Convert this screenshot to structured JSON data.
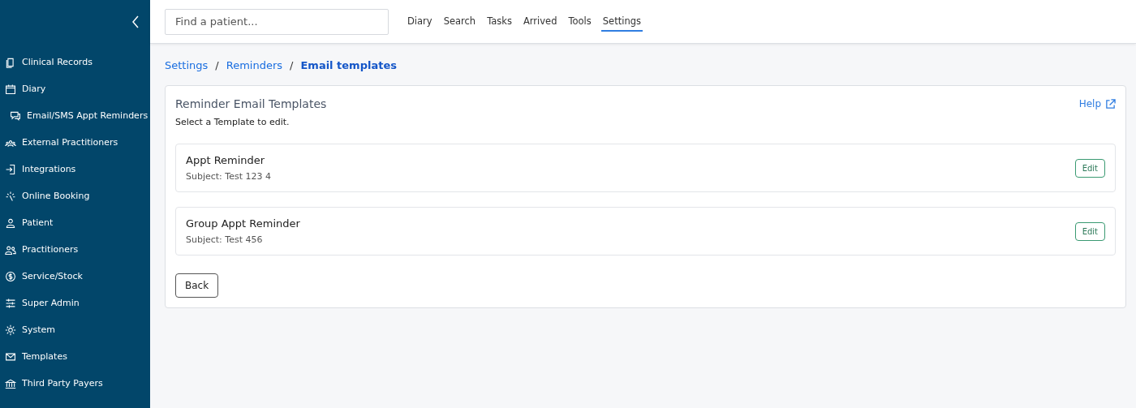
{
  "sidebar": {
    "items": [
      {
        "label": "Clinical Records"
      },
      {
        "label": "Diary",
        "children": [
          {
            "label": "Email/SMS Appt Reminders"
          }
        ]
      },
      {
        "label": "External Practitioners"
      },
      {
        "label": "Integrations"
      },
      {
        "label": "Online Booking"
      },
      {
        "label": "Patient"
      },
      {
        "label": "Practitioners"
      },
      {
        "label": "Service/Stock"
      },
      {
        "label": "Super Admin"
      },
      {
        "label": "System"
      },
      {
        "label": "Templates"
      },
      {
        "label": "Third Party Payers"
      }
    ]
  },
  "search": {
    "placeholder": "Find a patient..."
  },
  "nav": [
    {
      "label": "Diary",
      "selected": false
    },
    {
      "label": "Search",
      "selected": false
    },
    {
      "label": "Tasks",
      "selected": false
    },
    {
      "label": "Arrived",
      "selected": false
    },
    {
      "label": "Tools",
      "selected": false
    },
    {
      "label": "Settings",
      "selected": true
    }
  ],
  "breadcrumb": [
    {
      "label": "Settings",
      "current": false
    },
    {
      "label": "Reminders",
      "current": false
    },
    {
      "label": "Email templates",
      "current": true
    }
  ],
  "breadcrumb_separator": "/",
  "panel": {
    "title": "Reminder Email Templates",
    "help": "Help",
    "subtitle": "Select a Template to edit.",
    "templates": [
      {
        "name": "Appt Reminder",
        "subject": "Subject: Test 123 4",
        "action": "Edit"
      },
      {
        "name": "Group Appt Reminder",
        "subject": "Subject: Test 456",
        "action": "Edit"
      }
    ],
    "back": "Back"
  }
}
